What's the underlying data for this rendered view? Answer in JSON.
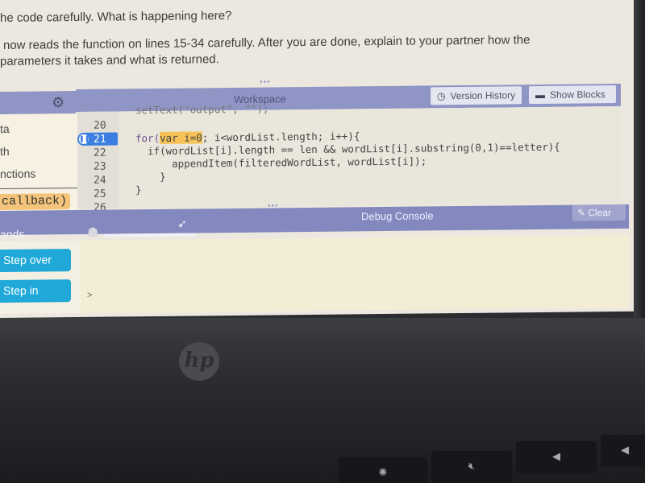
{
  "instructions": {
    "line1": "he code carefully. What is happening here?",
    "line2": "now reads the function on lines 15-34 carefully. After you are done, explain to your partner how the",
    "line3": "parameters it takes and what is returned."
  },
  "toolbox": {
    "items": [
      "ta",
      "th",
      "nctions"
    ],
    "chip": "callback)"
  },
  "workspace": {
    "title": "Workspace",
    "version_history": "Version History",
    "show_blocks": "Show Blocks",
    "line_numbers": [
      "20",
      "21",
      "22",
      "23",
      "24",
      "25",
      "26"
    ],
    "active_line": "21",
    "clipped_line": "setText(\"output\", \"\");",
    "code": {
      "line21_pre": "for(",
      "line21_hl": "var i=0",
      "line21_post": "; i<wordList.length; i++){",
      "line22": "  if(wordList[i].length == len && wordList[i].substring(0,1)==letter){",
      "line23": "      appendItem(filteredWordList, wordList[i]);",
      "line24": "    }",
      "line25": "}"
    }
  },
  "debug": {
    "left_label": "ands",
    "title": "Debug Console",
    "clear": "Clear",
    "step_over": "Step over",
    "step_in": "Step in",
    "prompt": ">",
    "speed_slider": 0.95
  },
  "laptop": {
    "brand": "hp"
  }
}
